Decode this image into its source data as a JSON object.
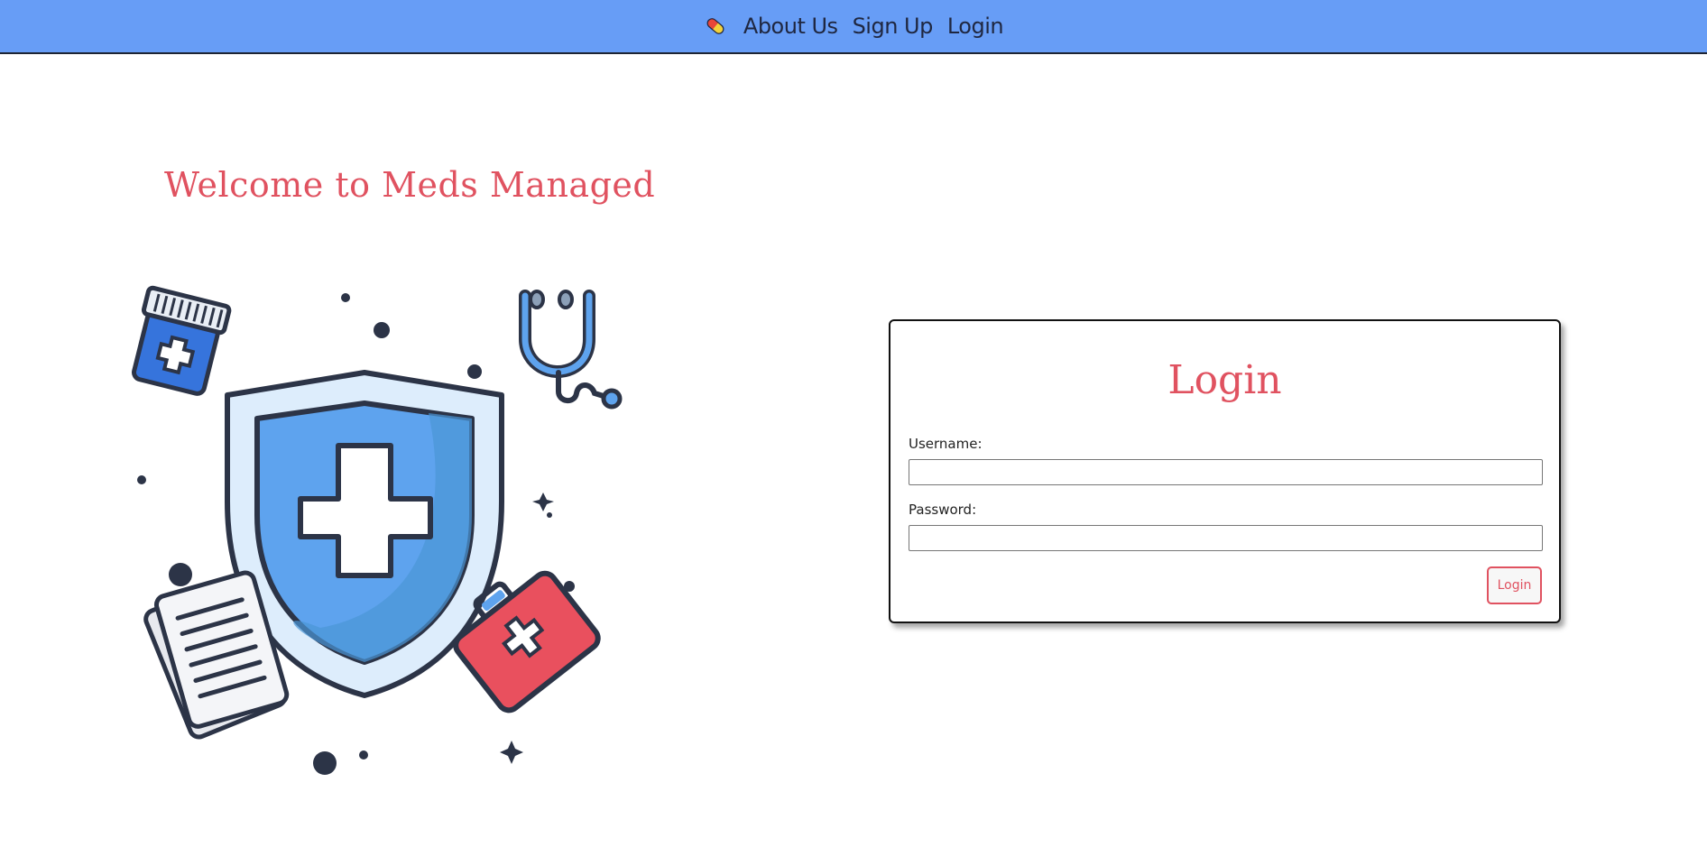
{
  "nav": {
    "logo_icon": "pill-icon",
    "links": [
      "About Us",
      "Sign Up",
      "Login"
    ]
  },
  "welcome": "Welcome to Meds Managed",
  "hero_icons": [
    "shield-icon",
    "pill-bottle-icon",
    "stethoscope-icon",
    "clipboard-icon",
    "medical-kit-icon"
  ],
  "login": {
    "title": "Login",
    "username_label": "Username:",
    "username_value": "",
    "password_label": "Password:",
    "password_value": "",
    "button": "Login"
  },
  "colors": {
    "navbar": "#679df6",
    "accent": "#e05260",
    "shield": "#5ea3ee",
    "kit": "#e05260"
  }
}
